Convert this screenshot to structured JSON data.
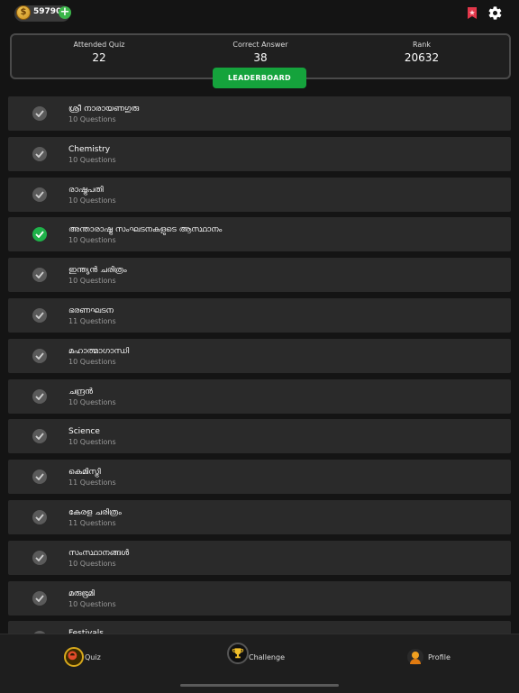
{
  "header": {
    "coins": "59790",
    "coin_icon": "coin-icon",
    "add_icon": "plus-icon",
    "bookmark_icon": "bookmark-icon",
    "settings_icon": "gear-icon"
  },
  "stats": {
    "attended_label": "Attended Quiz",
    "attended_value": "22",
    "correct_label": "Correct Answer",
    "correct_value": "38",
    "rank_label": "Rank",
    "rank_value": "20632",
    "leaderboard_label": "LEADERBOARD"
  },
  "quizzes": [
    {
      "title": "ശ്രീ നാരായണഗുരു",
      "count": "10 Questions",
      "done": false
    },
    {
      "title": "Chemistry",
      "count": "10 Questions",
      "done": false
    },
    {
      "title": "രാഷ്ട്രപതി",
      "count": "10 Questions",
      "done": false
    },
    {
      "title": "അന്താരാഷ്ട്ര സംഘടനകളുടെ ആസ്ഥാനം",
      "count": "10 Questions",
      "done": true
    },
    {
      "title": "ഇന്ത്യൻ ചരിത്രം",
      "count": "10 Questions",
      "done": false
    },
    {
      "title": "ഭരണഘടന",
      "count": "11 Questions",
      "done": false
    },
    {
      "title": "മഹാത്മാഗാന്ധി",
      "count": "10 Questions",
      "done": false
    },
    {
      "title": "ചന്ദ്രൻ",
      "count": "10 Questions",
      "done": false
    },
    {
      "title": "Science",
      "count": "10 Questions",
      "done": false
    },
    {
      "title": "കെമിസ്ട്രി",
      "count": "11 Questions",
      "done": false
    },
    {
      "title": "കേരള ചരിത്രം",
      "count": "11 Questions",
      "done": false
    },
    {
      "title": "സംസ്ഥാനങ്ങൾ",
      "count": "10 Questions",
      "done": false
    },
    {
      "title": "മരുഭൂമി",
      "count": "10 Questions",
      "done": false
    },
    {
      "title": "Festivals",
      "count": "",
      "done": false
    }
  ],
  "nav": {
    "quiz_label": "Quiz",
    "challenge_label": "Challenge",
    "profile_label": "Profile"
  },
  "colors": {
    "background": "#141414",
    "row": "#2a2a2a",
    "accent_green": "#15a33c",
    "check_done": "#1fb24a"
  }
}
